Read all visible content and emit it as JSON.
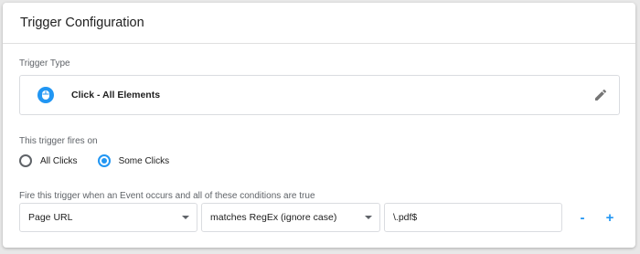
{
  "card": {
    "title": "Trigger Configuration"
  },
  "trigger_type": {
    "label": "Trigger Type",
    "name": "Click - All Elements",
    "icon": "mouse-icon",
    "icon_color": "#2196f3"
  },
  "fires_on": {
    "label": "This trigger fires on",
    "options": [
      {
        "label": "All Clicks",
        "selected": false
      },
      {
        "label": "Some Clicks",
        "selected": true
      }
    ]
  },
  "conditions": {
    "label": "Fire this trigger when an Event occurs and all of these conditions are true",
    "variable": "Page URL",
    "operator": "matches RegEx (ignore case)",
    "value": "\\.pdf$",
    "remove_label": "-",
    "add_label": "+"
  },
  "colors": {
    "accent": "#2196f3",
    "border": "#dadce0",
    "text": "#212121",
    "muted": "#5f6368"
  }
}
